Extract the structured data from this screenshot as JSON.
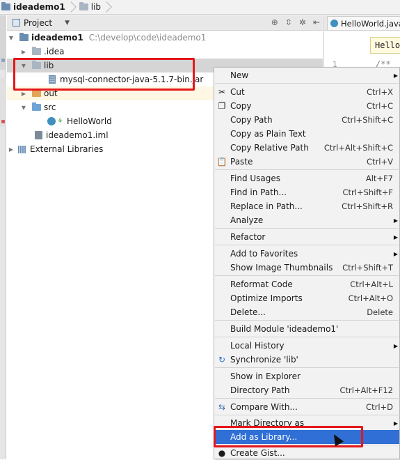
{
  "breadcrumb": [
    {
      "label": "ideademo1"
    },
    {
      "label": "lib"
    }
  ],
  "project_panel": {
    "title": "Project",
    "header_tools": [
      "target-icon",
      "collapse-icon",
      "gear-icon",
      "hide-icon"
    ]
  },
  "editor": {
    "tab_label": "HelloWorld.java",
    "banner_text": "Hello",
    "gutter_number": "1",
    "code_text": "/**"
  },
  "tree": [
    {
      "label": "ideademo1",
      "hint": "C:\\develop\\code\\ideademo1"
    },
    {
      "label": ".idea"
    },
    {
      "label": "lib"
    },
    {
      "label": "mysql-connector-java-5.1.7-bin.jar"
    },
    {
      "label": "out"
    },
    {
      "label": "src"
    },
    {
      "label": "HelloWorld"
    },
    {
      "label": "ideademo1.iml"
    },
    {
      "label": "External Libraries"
    }
  ],
  "menu": [
    {
      "label": "New",
      "shortcut": ""
    },
    {
      "label": "Cut",
      "shortcut": "Ctrl+X"
    },
    {
      "label": "Copy",
      "shortcut": "Ctrl+C"
    },
    {
      "label": "Copy Path",
      "shortcut": "Ctrl+Shift+C"
    },
    {
      "label": "Copy as Plain Text",
      "shortcut": ""
    },
    {
      "label": "Copy Relative Path",
      "shortcut": "Ctrl+Alt+Shift+C"
    },
    {
      "label": "Paste",
      "shortcut": "Ctrl+V"
    },
    {
      "label": "Find Usages",
      "shortcut": "Alt+F7"
    },
    {
      "label": "Find in Path...",
      "shortcut": "Ctrl+Shift+F"
    },
    {
      "label": "Replace in Path...",
      "shortcut": "Ctrl+Shift+R"
    },
    {
      "label": "Analyze",
      "shortcut": ""
    },
    {
      "label": "Refactor",
      "shortcut": ""
    },
    {
      "label": "Add to Favorites",
      "shortcut": ""
    },
    {
      "label": "Show Image Thumbnails",
      "shortcut": "Ctrl+Shift+T"
    },
    {
      "label": "Reformat Code",
      "shortcut": "Ctrl+Alt+L"
    },
    {
      "label": "Optimize Imports",
      "shortcut": "Ctrl+Alt+O"
    },
    {
      "label": "Delete...",
      "shortcut": "Delete"
    },
    {
      "label": "Build Module 'ideademo1'",
      "shortcut": ""
    },
    {
      "label": "Local History",
      "shortcut": ""
    },
    {
      "label": "Synchronize 'lib'",
      "shortcut": ""
    },
    {
      "label": "Show in Explorer",
      "shortcut": ""
    },
    {
      "label": "Directory Path",
      "shortcut": "Ctrl+Alt+F12"
    },
    {
      "label": "Compare With...",
      "shortcut": "Ctrl+D"
    },
    {
      "label": "Mark Directory as",
      "shortcut": ""
    },
    {
      "label": "Add as Library...",
      "shortcut": ""
    },
    {
      "label": "Create Gist...",
      "shortcut": ""
    }
  ],
  "colors": {
    "highlight": "#2f6fd6",
    "annotation_box": "#e5161b",
    "selected_row": "#d5d5d5"
  }
}
